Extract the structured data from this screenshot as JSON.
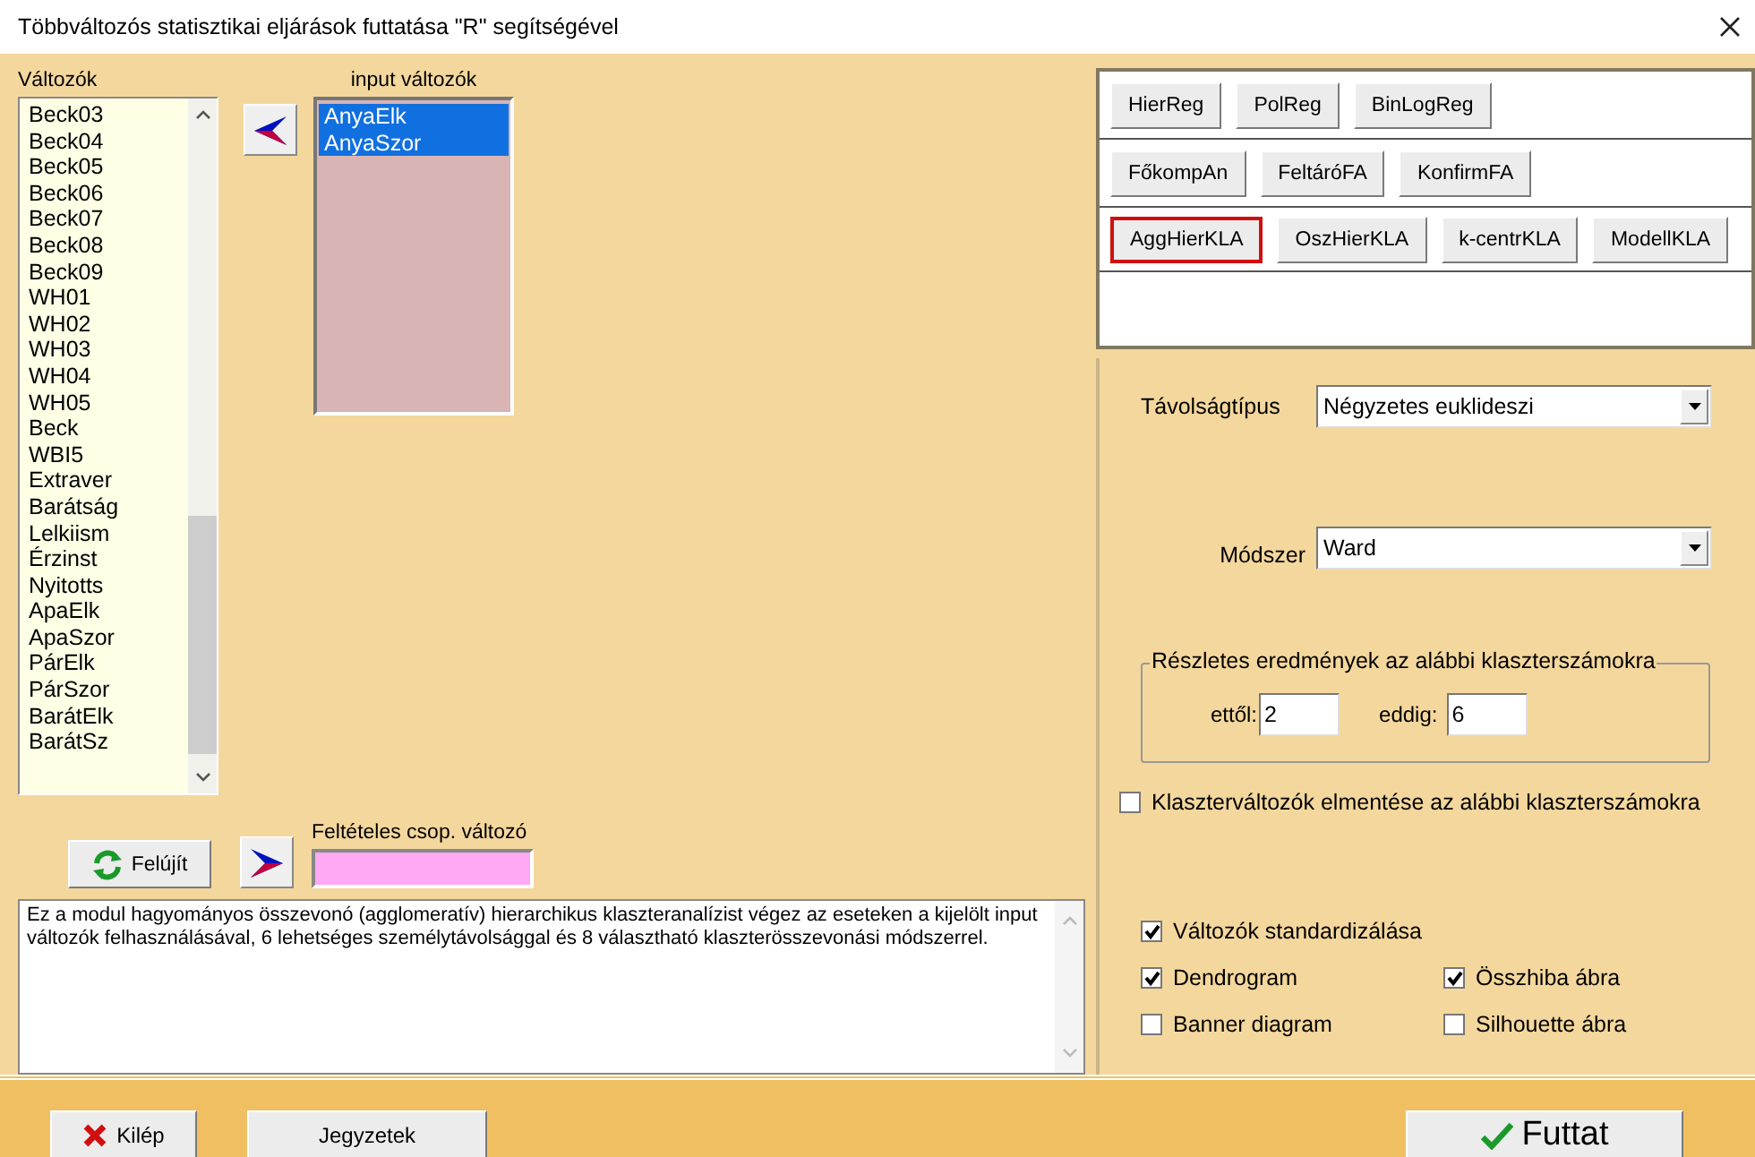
{
  "window": {
    "title": "Többváltozós statisztikai eljárások futtatása \"R\" segítségével"
  },
  "variables": {
    "label": "Változók",
    "items": [
      {
        "label": "Beck03",
        "selected": false
      },
      {
        "label": "Beck04",
        "selected": false
      },
      {
        "label": "Beck05",
        "selected": false
      },
      {
        "label": "Beck06",
        "selected": false
      },
      {
        "label": "Beck07",
        "selected": false
      },
      {
        "label": "Beck08",
        "selected": false
      },
      {
        "label": "Beck09",
        "selected": false
      },
      {
        "label": "WH01",
        "selected": false
      },
      {
        "label": "WH02",
        "selected": false
      },
      {
        "label": "WH03",
        "selected": false
      },
      {
        "label": "WH04",
        "selected": false
      },
      {
        "label": "WH05",
        "selected": false
      },
      {
        "label": "Beck",
        "selected": false
      },
      {
        "label": "WBI5",
        "selected": false
      },
      {
        "label": "Extraver",
        "selected": false
      },
      {
        "label": "Barátság",
        "selected": false
      },
      {
        "label": "Lelkiism",
        "selected": false
      },
      {
        "label": "Érzinst",
        "selected": false
      },
      {
        "label": "Nyitotts",
        "selected": false
      },
      {
        "label": "ApaElk",
        "selected": false
      },
      {
        "label": "ApaSzor",
        "selected": false
      },
      {
        "label": "PárElk",
        "selected": false
      },
      {
        "label": "PárSzor",
        "selected": false
      },
      {
        "label": "BarátElk",
        "selected": false
      },
      {
        "label": "BarátSz",
        "selected": false
      }
    ]
  },
  "input_variables": {
    "label": "input változók",
    "items": [
      {
        "label": "AnyaElk",
        "selected": true
      },
      {
        "label": "AnyaSzor",
        "selected": true
      }
    ]
  },
  "refresh_button": {
    "label": "Felújít"
  },
  "condition_field": {
    "label": "Feltételes csop. változó"
  },
  "description": "Ez a modul hagyományos összevonó (agglomeratív) hierarchikus klaszteranalízist végez az eseteken a kijelölt input változók felhasználásával, 6 lehetséges személytávolsággal és 8 választható klaszterösszevonási módszerrel.",
  "method_rows": [
    {
      "buttons": [
        {
          "label": "HierReg",
          "selected": false
        },
        {
          "label": "PolReg",
          "selected": false
        },
        {
          "label": "BinLogReg",
          "selected": false
        }
      ]
    },
    {
      "buttons": [
        {
          "label": "FőkompAn",
          "selected": false
        },
        {
          "label": "FeltáróFA",
          "selected": false
        },
        {
          "label": "KonfirmFA",
          "selected": false
        }
      ]
    },
    {
      "buttons": [
        {
          "label": "AggHierKLA",
          "selected": true
        },
        {
          "label": "OszHierKLA",
          "selected": false
        },
        {
          "label": "k-centrKLA",
          "selected": false
        },
        {
          "label": "ModellKLA",
          "selected": false
        }
      ]
    }
  ],
  "distance": {
    "label": "Távolságtípus",
    "value": "Négyzetes euklideszi"
  },
  "method": {
    "label": "Módszer",
    "value": "Ward"
  },
  "detail_group": {
    "title": "Részletes eredmények az alábbi klaszterszámokra",
    "from": {
      "label": "ettől:",
      "value": "2"
    },
    "to": {
      "label": "eddig:",
      "value": "6"
    }
  },
  "save_checkbox": {
    "label": "Klaszterváltozók elmentése az alábbi klaszterszámokra",
    "checked": false
  },
  "option_rows": [
    {
      "items": [
        {
          "label": "Változók standardizálása",
          "checked": true
        }
      ]
    },
    {
      "items": [
        {
          "label": "Dendrogram",
          "checked": true
        },
        {
          "label": "Összhiba ábra",
          "checked": true
        }
      ]
    },
    {
      "items": [
        {
          "label": "Banner diagram",
          "checked": false
        },
        {
          "label": "Silhouette ábra",
          "checked": false
        }
      ]
    }
  ],
  "footer": {
    "exit": "Kilép",
    "notes": "Jegyzetek",
    "run": "Futtat"
  }
}
